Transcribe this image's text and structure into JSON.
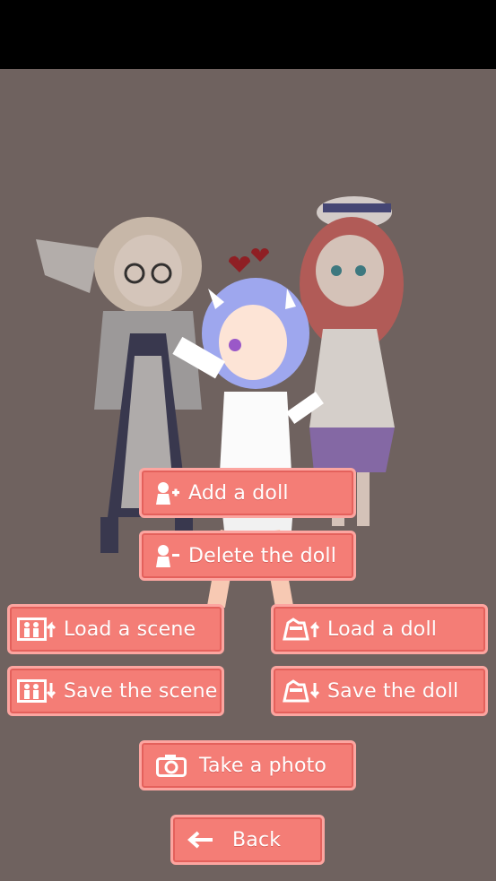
{
  "buttons": {
    "add_doll": "Add a doll",
    "delete_doll": "Delete the doll",
    "load_scene": "Load a scene",
    "load_doll": "Load a doll",
    "save_scene": "Save the scene",
    "save_doll": "Save the doll",
    "take_photo": "Take a photo",
    "back": "Back"
  },
  "colors": {
    "background": "#6f625f",
    "button": "#f47d76",
    "button_border": "#fca5a0"
  },
  "icons": [
    "add-person-icon",
    "remove-person-icon",
    "load-scene-icon",
    "load-doll-icon",
    "save-scene-icon",
    "save-doll-icon",
    "camera-icon",
    "back-arrow-icon"
  ]
}
